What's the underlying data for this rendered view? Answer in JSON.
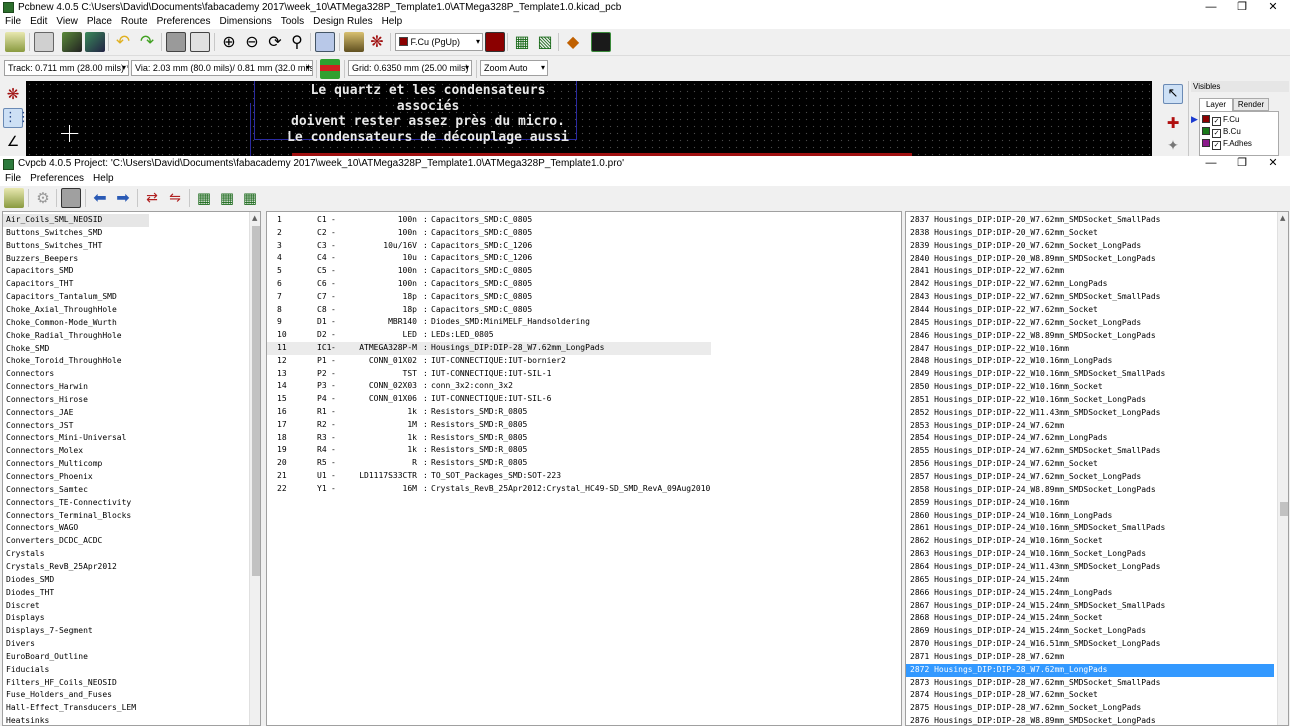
{
  "pcbnew": {
    "title": "Pcbnew 4.0.5 C:\\Users\\David\\Documents\\fabacademy 2017\\week_10\\ATMega328P_Template1.0\\ATMega328P_Template1.0.kicad_pcb",
    "menu": [
      "File",
      "Edit",
      "View",
      "Place",
      "Route",
      "Preferences",
      "Dimensions",
      "Tools",
      "Design Rules",
      "Help"
    ],
    "layer_select": "F.Cu (PgUp)",
    "track": "Track: 0.711 mm (28.00 mils) *",
    "via": "Via: 2.03 mm (80.0 mils)/ 0.81 mm (32.0 mils) *",
    "grid": "Grid: 0.6350 mm (25.00 mils)",
    "zoom": "Zoom Auto",
    "canvas_text": [
      "Le quartz et les condensateurs associés",
      "doivent rester assez près du micro.",
      "Le condensateurs de découplage aussi"
    ],
    "visibles": {
      "title": "Visibles",
      "tabs": [
        "Layer",
        "Render"
      ],
      "layers": [
        {
          "name": "F.Cu",
          "color": "#8b0000"
        },
        {
          "name": "B.Cu",
          "color": "#1a7a1a"
        },
        {
          "name": "F.Adhes",
          "color": "#8b1a8b"
        }
      ]
    }
  },
  "cvpcb": {
    "title": "Cvpcb 4.0.5  Project: 'C:\\Users\\David\\Documents\\fabacademy 2017\\week_10\\ATMega328P_Template1.0\\ATMega328P_Template1.0.pro'",
    "menu": [
      "File",
      "Preferences",
      "Help"
    ],
    "libraries": [
      "Air_Coils_SML_NEOSID",
      "Buttons_Switches_SMD",
      "Buttons_Switches_THT",
      "Buzzers_Beepers",
      "Capacitors_SMD",
      "Capacitors_THT",
      "Capacitors_Tantalum_SMD",
      "Choke_Axial_ThroughHole",
      "Choke_Common-Mode_Wurth",
      "Choke_Radial_ThroughHole",
      "Choke_SMD",
      "Choke_Toroid_ThroughHole",
      "Connectors",
      "Connectors_Harwin",
      "Connectors_Hirose",
      "Connectors_JAE",
      "Connectors_JST",
      "Connectors_Mini-Universal",
      "Connectors_Molex",
      "Connectors_Multicomp",
      "Connectors_Phoenix",
      "Connectors_Samtec",
      "Connectors_TE-Connectivity",
      "Connectors_Terminal_Blocks",
      "Connectors_WAGO",
      "Converters_DCDC_ACDC",
      "Crystals",
      "Crystals_RevB_25Apr2012",
      "Diodes_SMD",
      "Diodes_THT",
      "Discret",
      "Displays",
      "Displays_7-Segment",
      "Divers",
      "EuroBoard_Outline",
      "Fiducials",
      "Filters_HF_Coils_NEOSID",
      "Fuse_Holders_and_Fuses",
      "Hall-Effect_Transducers_LEM",
      "Heatsinks"
    ],
    "components": [
      {
        "n": "1",
        "ref": "C1",
        "value": "100n",
        "fp": "Capacitors_SMD:C_0805"
      },
      {
        "n": "2",
        "ref": "C2",
        "value": "100n",
        "fp": "Capacitors_SMD:C_0805"
      },
      {
        "n": "3",
        "ref": "C3",
        "value": "10u/16V",
        "fp": "Capacitors_SMD:C_1206"
      },
      {
        "n": "4",
        "ref": "C4",
        "value": "10u",
        "fp": "Capacitors_SMD:C_1206"
      },
      {
        "n": "5",
        "ref": "C5",
        "value": "100n",
        "fp": "Capacitors_SMD:C_0805"
      },
      {
        "n": "6",
        "ref": "C6",
        "value": "100n",
        "fp": "Capacitors_SMD:C_0805"
      },
      {
        "n": "7",
        "ref": "C7",
        "value": "18p",
        "fp": "Capacitors_SMD:C_0805"
      },
      {
        "n": "8",
        "ref": "C8",
        "value": "18p",
        "fp": "Capacitors_SMD:C_0805"
      },
      {
        "n": "9",
        "ref": "D1",
        "value": "MBR140",
        "fp": "Diodes_SMD:MiniMELF_Handsoldering"
      },
      {
        "n": "10",
        "ref": "D2",
        "value": "LED",
        "fp": "LEDs:LED_0805"
      },
      {
        "n": "11",
        "ref": "IC1",
        "value": "ATMEGA328P-M",
        "fp": "Housings_DIP:DIP-28_W7.62mm_LongPads"
      },
      {
        "n": "12",
        "ref": "P1",
        "value": "CONN_01X02",
        "fp": "IUT-CONNECTIQUE:IUT-bornier2"
      },
      {
        "n": "13",
        "ref": "P2",
        "value": "TST",
        "fp": "IUT-CONNECTIQUE:IUT-SIL-1"
      },
      {
        "n": "14",
        "ref": "P3",
        "value": "CONN_02X03",
        "fp": "conn_3x2:conn_3x2"
      },
      {
        "n": "15",
        "ref": "P4",
        "value": "CONN_01X06",
        "fp": "IUT-CONNECTIQUE:IUT-SIL-6"
      },
      {
        "n": "16",
        "ref": "R1",
        "value": "1k",
        "fp": "Resistors_SMD:R_0805"
      },
      {
        "n": "17",
        "ref": "R2",
        "value": "1M",
        "fp": "Resistors_SMD:R_0805"
      },
      {
        "n": "18",
        "ref": "R3",
        "value": "1k",
        "fp": "Resistors_SMD:R_0805"
      },
      {
        "n": "19",
        "ref": "R4",
        "value": "1k",
        "fp": "Resistors_SMD:R_0805"
      },
      {
        "n": "20",
        "ref": "R5",
        "value": "R",
        "fp": "Resistors_SMD:R_0805"
      },
      {
        "n": "21",
        "ref": "U1",
        "value": "LD1117S33CTR",
        "fp": "TO_SOT_Packages_SMD:SOT-223"
      },
      {
        "n": "22",
        "ref": "Y1",
        "value": "16M",
        "fp": "Crystals_RevB_25Apr2012:Crystal_HC49-SD_SMD_RevA_09Aug2010"
      }
    ],
    "selected_component": 10,
    "footprints": [
      "2837 Housings_DIP:DIP-20_W7.62mm_SMDSocket_SmallPads",
      "2838 Housings_DIP:DIP-20_W7.62mm_Socket",
      "2839 Housings_DIP:DIP-20_W7.62mm_Socket_LongPads",
      "2840 Housings_DIP:DIP-20_W8.89mm_SMDSocket_LongPads",
      "2841 Housings_DIP:DIP-22_W7.62mm",
      "2842 Housings_DIP:DIP-22_W7.62mm_LongPads",
      "2843 Housings_DIP:DIP-22_W7.62mm_SMDSocket_SmallPads",
      "2844 Housings_DIP:DIP-22_W7.62mm_Socket",
      "2845 Housings_DIP:DIP-22_W7.62mm_Socket_LongPads",
      "2846 Housings_DIP:DIP-22_W8.89mm_SMDSocket_LongPads",
      "2847 Housings_DIP:DIP-22_W10.16mm",
      "2848 Housings_DIP:DIP-22_W10.16mm_LongPads",
      "2849 Housings_DIP:DIP-22_W10.16mm_SMDSocket_SmallPads",
      "2850 Housings_DIP:DIP-22_W10.16mm_Socket",
      "2851 Housings_DIP:DIP-22_W10.16mm_Socket_LongPads",
      "2852 Housings_DIP:DIP-22_W11.43mm_SMDSocket_LongPads",
      "2853 Housings_DIP:DIP-24_W7.62mm",
      "2854 Housings_DIP:DIP-24_W7.62mm_LongPads",
      "2855 Housings_DIP:DIP-24_W7.62mm_SMDSocket_SmallPads",
      "2856 Housings_DIP:DIP-24_W7.62mm_Socket",
      "2857 Housings_DIP:DIP-24_W7.62mm_Socket_LongPads",
      "2858 Housings_DIP:DIP-24_W8.89mm_SMDSocket_LongPads",
      "2859 Housings_DIP:DIP-24_W10.16mm",
      "2860 Housings_DIP:DIP-24_W10.16mm_LongPads",
      "2861 Housings_DIP:DIP-24_W10.16mm_SMDSocket_SmallPads",
      "2862 Housings_DIP:DIP-24_W10.16mm_Socket",
      "2863 Housings_DIP:DIP-24_W10.16mm_Socket_LongPads",
      "2864 Housings_DIP:DIP-24_W11.43mm_SMDSocket_LongPads",
      "2865 Housings_DIP:DIP-24_W15.24mm",
      "2866 Housings_DIP:DIP-24_W15.24mm_LongPads",
      "2867 Housings_DIP:DIP-24_W15.24mm_SMDSocket_SmallPads",
      "2868 Housings_DIP:DIP-24_W15.24mm_Socket",
      "2869 Housings_DIP:DIP-24_W15.24mm_Socket_LongPads",
      "2870 Housings_DIP:DIP-24_W16.51mm_SMDSocket_LongPads",
      "2871 Housings_DIP:DIP-28_W7.62mm",
      "2872 Housings_DIP:DIP-28_W7.62mm_LongPads",
      "2873 Housings_DIP:DIP-28_W7.62mm_SMDSocket_SmallPads",
      "2874 Housings_DIP:DIP-28_W7.62mm_Socket",
      "2875 Housings_DIP:DIP-28_W7.62mm_Socket_LongPads",
      "2876 Housings_DIP:DIP-28_W8.89mm_SMDSocket_LongPads"
    ],
    "selected_footprint": 35,
    "selection_color": "#3399ff"
  }
}
